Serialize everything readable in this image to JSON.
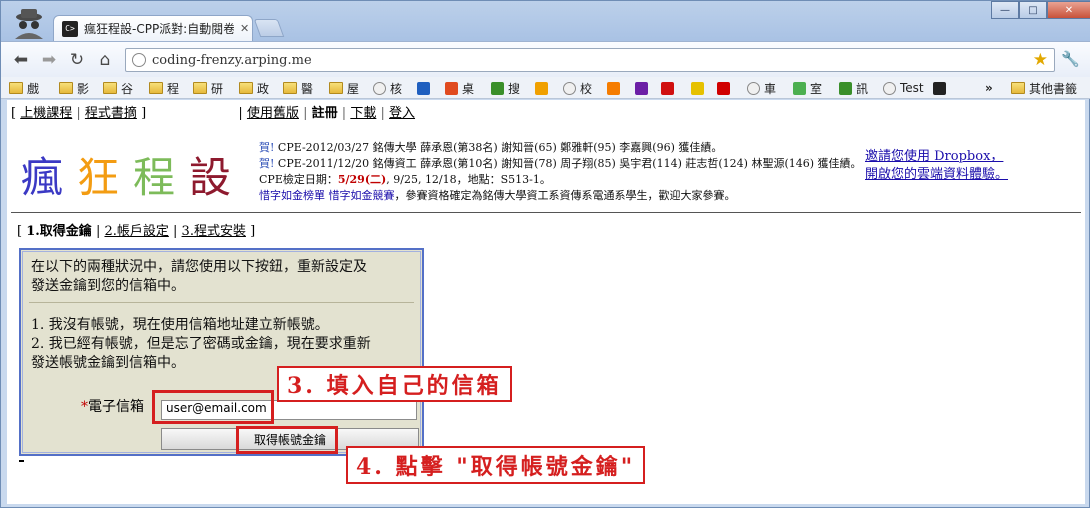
{
  "browser": {
    "tab_title": "瘋狂程設-CPP派對:自動閱卷",
    "tab_favicon_text": "C>",
    "url": "coding-frenzy.arping.me",
    "window_controls": [
      "—",
      "□",
      "✕"
    ],
    "nav_icons": [
      "back-icon",
      "forward-icon",
      "reload-icon",
      "home-icon"
    ]
  },
  "bookmarks": [
    {
      "label": "戲",
      "icon": "folder",
      "color": "#e6b93c"
    },
    {
      "label": "影",
      "icon": "folder",
      "color": "#e6b93c"
    },
    {
      "label": "谷",
      "icon": "folder",
      "color": "#e6b93c"
    },
    {
      "label": "程",
      "icon": "folder",
      "color": "#e6b93c"
    },
    {
      "label": "研",
      "icon": "folder",
      "color": "#e6b93c"
    },
    {
      "label": "政",
      "icon": "folder",
      "color": "#e6b93c"
    },
    {
      "label": "醫",
      "icon": "folder",
      "color": "#e6b93c"
    },
    {
      "label": "屋",
      "icon": "folder",
      "color": "#e6b93c"
    },
    {
      "label": "核",
      "icon": "globe",
      "color": "#aaaaaa"
    },
    {
      "label": "",
      "icon": "sq",
      "color": "#1f5fbf"
    },
    {
      "label": "桌",
      "icon": "sq",
      "color": "#e04a1f"
    },
    {
      "label": "搜",
      "icon": "sq",
      "color": "#3a8f2a"
    },
    {
      "label": "",
      "icon": "sq",
      "color": "#f0a000"
    },
    {
      "label": "校",
      "icon": "globe",
      "color": "#aaaaaa"
    },
    {
      "label": "",
      "icon": "sq",
      "color": "#f57c00"
    },
    {
      "label": "",
      "icon": "sq",
      "color": "#6b1fa6"
    },
    {
      "label": "",
      "icon": "sq",
      "color": "#d01010"
    },
    {
      "label": "",
      "icon": "sq",
      "color": "#e6c100"
    },
    {
      "label": "",
      "icon": "sq",
      "color": "#d00000"
    },
    {
      "label": "車",
      "icon": "globe",
      "color": "#aaaaaa"
    },
    {
      "label": "室",
      "icon": "sq",
      "color": "#4caf50"
    },
    {
      "label": "訊",
      "icon": "sq",
      "color": "#3a8f2a"
    },
    {
      "label": "Test",
      "icon": "globe",
      "color": "#aaaaaa"
    },
    {
      "label": "",
      "icon": "sq",
      "color": "#222222"
    }
  ],
  "bookmarks_overflow": "»",
  "bookmarks_other": "其他書籤",
  "page": {
    "topnav": {
      "open": "[",
      "link1": "上機課程",
      "sep1": "|",
      "link2": "程式書摘",
      "close": "]",
      "link3": "使用舊版",
      "sep2": "|",
      "current": "註冊",
      "sep3": "|",
      "link4": "下載",
      "sep4": "|",
      "link5": "登入"
    },
    "logo": [
      "瘋",
      "狂",
      "程",
      "設"
    ],
    "logo_colors": [
      "#3b39c4",
      "#f39c12",
      "#7dbb5a",
      "#8e1a2e"
    ],
    "news": {
      "line1_he": "賀!",
      "line1": " CPE-2012/03/27 銘傳大學 薛承恩(第38名) 謝知晉(65) 鄭雅軒(95) 李嘉興(96) 獲佳績。",
      "line2_he": "賀!",
      "line2": " CPE-2011/12/20 銘傳資工 薛承恩(第10名) 謝知晉(78) 周子翔(85) 吳宇君(114) 莊志哲(124) 林聖源(146) 獲佳績。",
      "line3_pre": "CPE檢定日期：",
      "line3_date": "5/29(二)",
      "line3_post": ", 9/25, 12/18，地點：S513-1。",
      "line4_link1": "惜字如金榜單",
      "line4_link2": "惜字如金競賽",
      "line4_post": "，參賽資格確定為銘傳大學資工系資傳系電通系學生，歡迎大家參賽。"
    },
    "dropbox_line1": "邀請您使用 Dropbox，",
    "dropbox_line2": "開啟您的雲端資料體驗。",
    "steps": {
      "open": "[",
      "current": "1.取得金鑰",
      "sep1": "|",
      "step2": "2.帳戶設定",
      "sep2": "|",
      "step3": "3.程式安裝",
      "close": "]"
    },
    "form": {
      "intro_line1": "在以下的兩種狀況中，請您使用以下按鈕，重新設定及",
      "intro_line2": "發送金鑰到您的信箱中。",
      "case1": "1. 我沒有帳號，現在使用信箱地址建立新帳號。",
      "case2_line1": "2. 我已經有帳號，但是忘了密碼或金鑰，現在要求重新",
      "case2_line2": "發送帳號金鑰到信箱中。",
      "required_mark": "*",
      "email_label": "電子信箱",
      "email_value": "user@email.com",
      "submit_label": "取得帳號金鑰"
    },
    "callouts": {
      "step3": "3. 填入自己的信箱",
      "step4": "4. 點擊 \"取得帳號金鑰\""
    },
    "accent_red": "#d51f1f",
    "form_border": "#5470c7"
  }
}
